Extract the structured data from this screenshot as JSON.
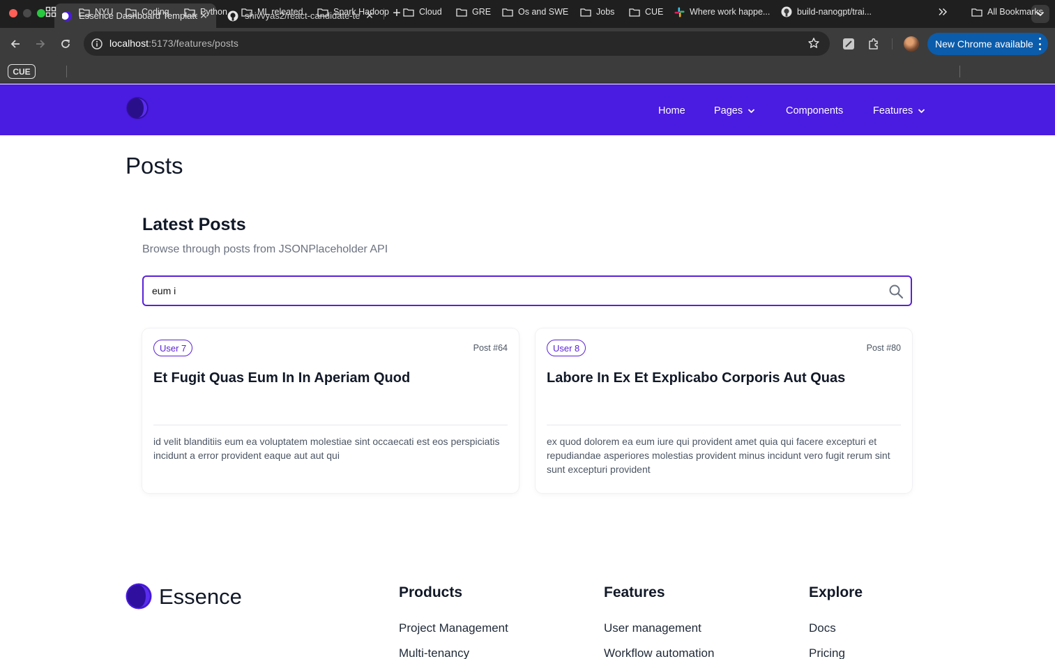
{
  "browser": {
    "tabs": [
      {
        "title": "Essence Dashboard Template",
        "active": true
      },
      {
        "title": "shivvyas2/react-candidate-te",
        "active": false
      }
    ],
    "url_host": "localhost",
    "url_rest": ":5173/features/posts",
    "update_button": "New Chrome available",
    "bookmarks": [
      {
        "label": "NYU",
        "icon": "folder-icon"
      },
      {
        "label": "Coding",
        "icon": "folder-icon"
      },
      {
        "label": "Python",
        "icon": "folder-icon"
      },
      {
        "label": "ML releated",
        "icon": "folder-icon"
      },
      {
        "label": "Spark Hadoop",
        "icon": "folder-icon"
      },
      {
        "label": "Cloud",
        "icon": "folder-icon"
      },
      {
        "label": "GRE",
        "icon": "folder-icon"
      },
      {
        "label": "Os and SWE",
        "icon": "folder-icon"
      },
      {
        "label": "Jobs",
        "icon": "folder-icon"
      },
      {
        "label": "CUE",
        "icon": "folder-icon"
      },
      {
        "label": "Where work happe...",
        "icon": "slack-icon"
      },
      {
        "label": "build-nanogpt/trai...",
        "icon": "github-icon"
      }
    ],
    "cue_badge": "CUE",
    "all_bookmarks": "All Bookmarks"
  },
  "nav": {
    "items": [
      {
        "label": "Home",
        "dropdown": false
      },
      {
        "label": "Pages",
        "dropdown": true
      },
      {
        "label": "Components",
        "dropdown": false
      },
      {
        "label": "Features",
        "dropdown": true
      }
    ]
  },
  "page": {
    "title": "Posts",
    "section_title": "Latest Posts",
    "section_subtitle": "Browse through posts from JSONPlaceholder API",
    "search_value": "eum i"
  },
  "posts": [
    {
      "user": "User 7",
      "post_number": "Post #64",
      "title": "Et Fugit Quas Eum In In Aperiam Quod",
      "body": "id velit blanditiis eum ea voluptatem molestiae sint occaecati est eos perspiciatis incidunt a error provident eaque aut aut qui"
    },
    {
      "user": "User 8",
      "post_number": "Post #80",
      "title": "Labore In Ex Et Explicabo Corporis Aut Quas",
      "body": "ex quod dolorem ea eum iure qui provident amet quia qui facere excepturi et repudiandae asperiores molestias provident minus incidunt vero fugit rerum sint sunt excepturi provident"
    }
  ],
  "footer": {
    "brand": "Essence",
    "columns": [
      {
        "title": "Products",
        "links": [
          "Project Management",
          "Multi-tenancy"
        ]
      },
      {
        "title": "Features",
        "links": [
          "User management",
          "Workflow automation"
        ]
      },
      {
        "title": "Explore",
        "links": [
          "Docs",
          "Pricing"
        ]
      }
    ]
  },
  "colors": {
    "brand": "#4a1be0",
    "accent": "#5b21d6",
    "chrome_update": "#0b5cab"
  }
}
